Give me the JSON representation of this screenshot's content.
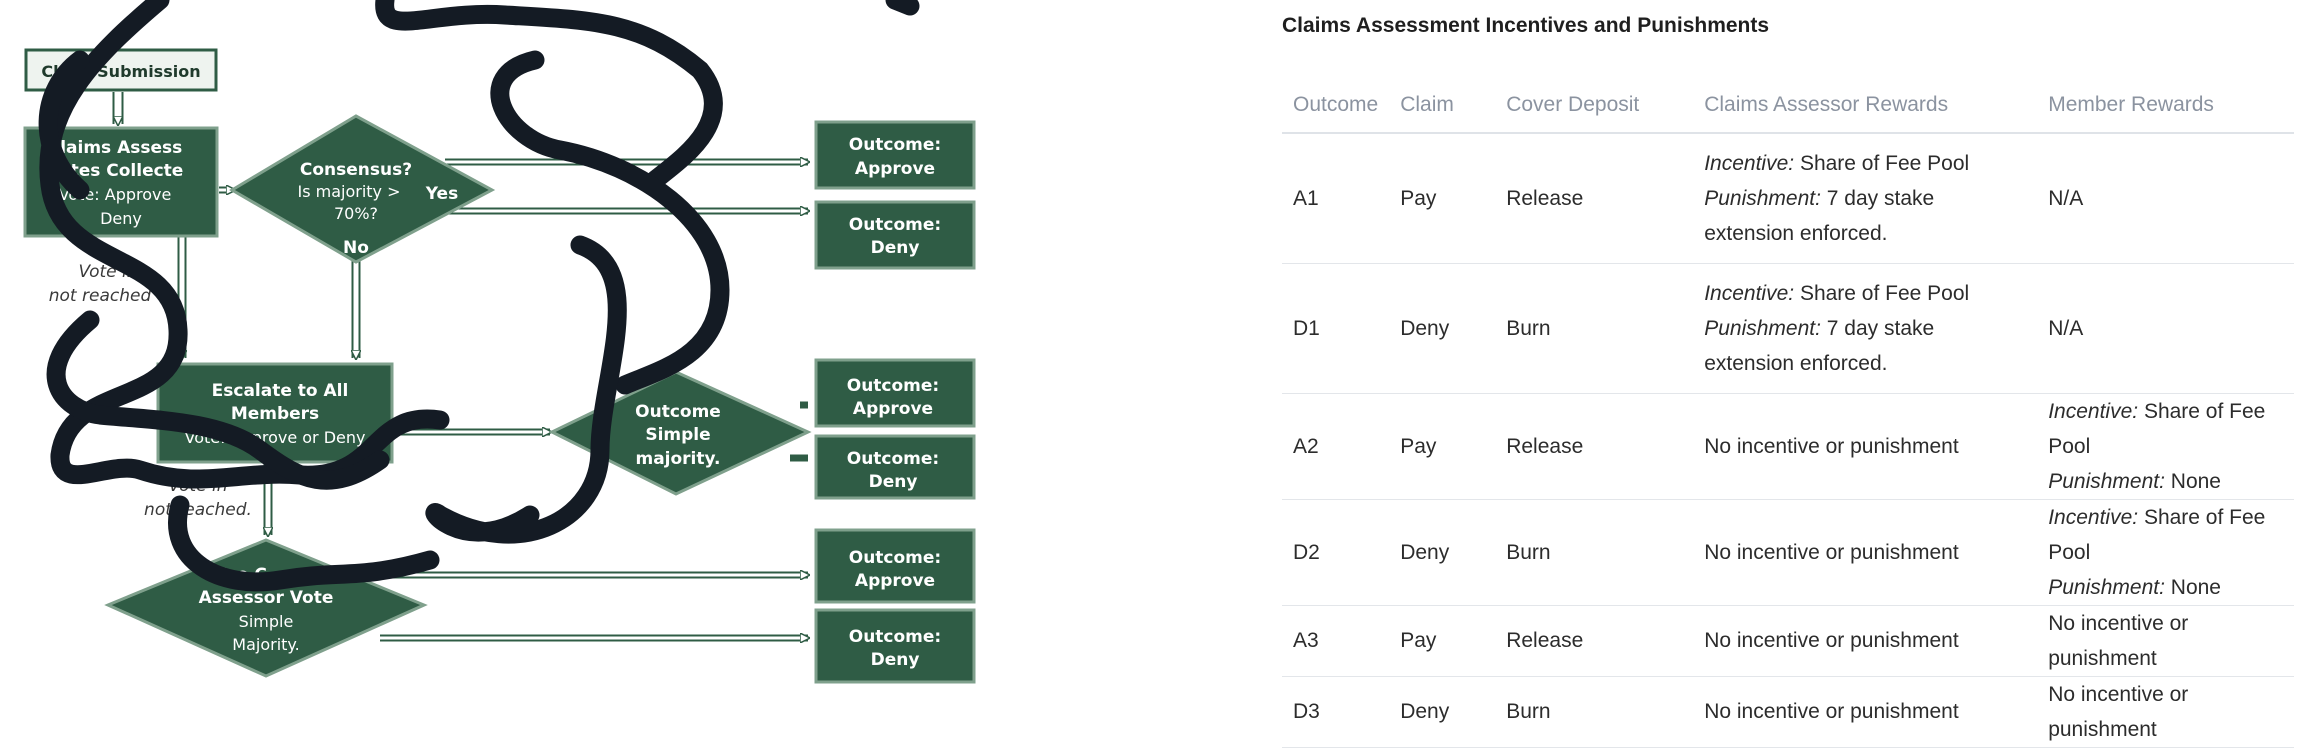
{
  "flowchart": {
    "claim_submission": "Claim Submission",
    "votes_collected": [
      "Claims Assess",
      "Votes Collecte",
      "Vote: Approve",
      "Deny"
    ],
    "consensus": [
      "Consensus?",
      "Is majority >",
      "70%?"
    ],
    "yes_label": "Yes",
    "no_label": "No",
    "vote_not_reached_1": [
      "Vote in",
      "not reached"
    ],
    "escalate": [
      "Escalate to All",
      "Members",
      "Vote: Approve or Deny"
    ],
    "vote_not_reached_2": [
      "Vote in",
      "not reached."
    ],
    "outcome_simple": [
      "Outcome",
      "Simple",
      "majority."
    ],
    "use_assessor": [
      "Use C",
      "Assessor Vote",
      "Simple",
      "Majority."
    ],
    "outcome_approve": [
      "Outcome:",
      "Approve"
    ],
    "outcome_deny": [
      "Outcome:",
      "Deny"
    ],
    "outcome_codes": [
      "A1",
      "D1",
      "A2",
      "D2",
      "A3",
      "D3"
    ],
    "colors": {
      "box": "#2f5c45",
      "box_border": "#7fa08c",
      "scribble": "#141b24"
    }
  },
  "table": {
    "title": "Claims Assessment Incentives and Punishments",
    "headers": [
      "Outcome",
      "Claim",
      "Cover Deposit",
      "Claims Assessor Rewards",
      "Member Rewards"
    ],
    "rows": [
      {
        "outcome": "A1",
        "claim": "Pay",
        "deposit": "Release",
        "assessor": {
          "incentive_label": "Incentive:",
          "incentive": "Share of Fee Pool",
          "punishment_label": "Punishment:",
          "punishment": "7 day stake extension enforced."
        },
        "member": "N/A"
      },
      {
        "outcome": "D1",
        "claim": "Deny",
        "deposit": "Burn",
        "assessor": {
          "incentive_label": "Incentive:",
          "incentive": "Share of Fee Pool",
          "punishment_label": "Punishment:",
          "punishment": "7 day stake extension enforced."
        },
        "member": "N/A"
      },
      {
        "outcome": "A2",
        "claim": "Pay",
        "deposit": "Release",
        "assessor": "No incentive or punishment",
        "member": {
          "incentive_label": "Incentive:",
          "incentive": "Share of Fee Pool",
          "punishment_label": "Punishment:",
          "punishment": "None"
        }
      },
      {
        "outcome": "D2",
        "claim": "Deny",
        "deposit": "Burn",
        "assessor": "No incentive or punishment",
        "member": {
          "incentive_label": "Incentive:",
          "incentive": "Share of Fee Pool",
          "punishment_label": "Punishment:",
          "punishment": "None"
        }
      },
      {
        "outcome": "A3",
        "claim": "Pay",
        "deposit": "Release",
        "assessor": "No incentive or punishment",
        "member": "No incentive or punishment"
      },
      {
        "outcome": "D3",
        "claim": "Deny",
        "deposit": "Burn",
        "assessor": "No incentive or punishment",
        "member": "No incentive or punishment"
      }
    ]
  }
}
